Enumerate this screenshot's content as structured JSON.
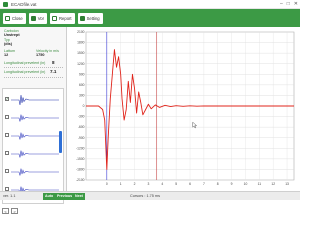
{
  "window": {
    "title": "ECADfile.vat",
    "controls": [
      "–",
      "□",
      "✕"
    ]
  },
  "toolbar": {
    "buttons": [
      {
        "label": "Close",
        "icon": "close-file-icon"
      },
      {
        "label": "Vor",
        "icon": "forward-icon"
      },
      {
        "label": "Report",
        "icon": "report-icon"
      },
      {
        "label": "Setting",
        "icon": "settings-icon"
      }
    ]
  },
  "left": {
    "field1_label": "Carboion",
    "field1_value": "Unstrept",
    "field2_label": "Typ",
    "field2_value": "(dis)",
    "left_label": "Lattum",
    "left_value": "12",
    "right_label": "Velocity in m/s",
    "right_value": "1750",
    "long_label_1": "Longitudinal prevelent (in)",
    "long_value_1": "8",
    "long_label_2": "Longitudinal prevelent (in)",
    "long_value_2": "7.1"
  },
  "traces": {
    "count": 6,
    "checked_index": 0
  },
  "list_buttons": [
    "<",
    ">"
  ],
  "chart_data": {
    "type": "line",
    "xlabel": "",
    "ylabel": "",
    "xlim": [
      -1.5,
      13.5
    ],
    "ylim": [
      -2100,
      2100
    ],
    "x_ticks": [
      0,
      1,
      2,
      3,
      4,
      5,
      6,
      7,
      8,
      9,
      10,
      11,
      12,
      13
    ],
    "y_ticks": [
      2100,
      1800,
      1500,
      1200,
      900,
      600,
      300,
      0,
      -300,
      -600,
      -900,
      -1200,
      -1500,
      -1800,
      -2100
    ],
    "cursor_lines_x": [
      0,
      3.6
    ],
    "grid": true,
    "series": [
      {
        "color": "#e0241b",
        "x": [
          -1.5,
          -0.6,
          -0.3,
          -0.15,
          0,
          0.1,
          0.25,
          0.4,
          0.55,
          0.7,
          0.85,
          1.0,
          1.1,
          1.25,
          1.4,
          1.55,
          1.7,
          1.85,
          2.0,
          2.15,
          2.3,
          2.45,
          2.6,
          2.8,
          3.0,
          3.2,
          3.5,
          3.8,
          4.2,
          4.6,
          5.0,
          5.5,
          6.0,
          6.5,
          7.0,
          8.0,
          9.0,
          10.0,
          11.0,
          12.0,
          13.0,
          13.5
        ],
        "y": [
          0,
          0,
          -100,
          -400,
          -1800,
          -900,
          200,
          900,
          1600,
          1100,
          1400,
          900,
          200,
          -400,
          -100,
          700,
          100,
          900,
          500,
          -200,
          400,
          100,
          -250,
          -100,
          50,
          -80,
          30,
          -40,
          20,
          -15,
          10,
          -8,
          6,
          -4,
          3,
          0,
          0,
          0,
          0,
          0,
          0,
          0
        ]
      }
    ],
    "cursor_marker": "mouse-pointer"
  },
  "status": {
    "version": "ver. 1.1",
    "tabs": [
      "Auto",
      "Previous",
      "Next"
    ],
    "cursor_text": "Cursors : 1.75 ms"
  },
  "colors": {
    "accent_green": "#3c9a45",
    "signal_red": "#e0241b",
    "cursor_blue": "#3b3bd6",
    "cursor_red": "#c74646"
  }
}
